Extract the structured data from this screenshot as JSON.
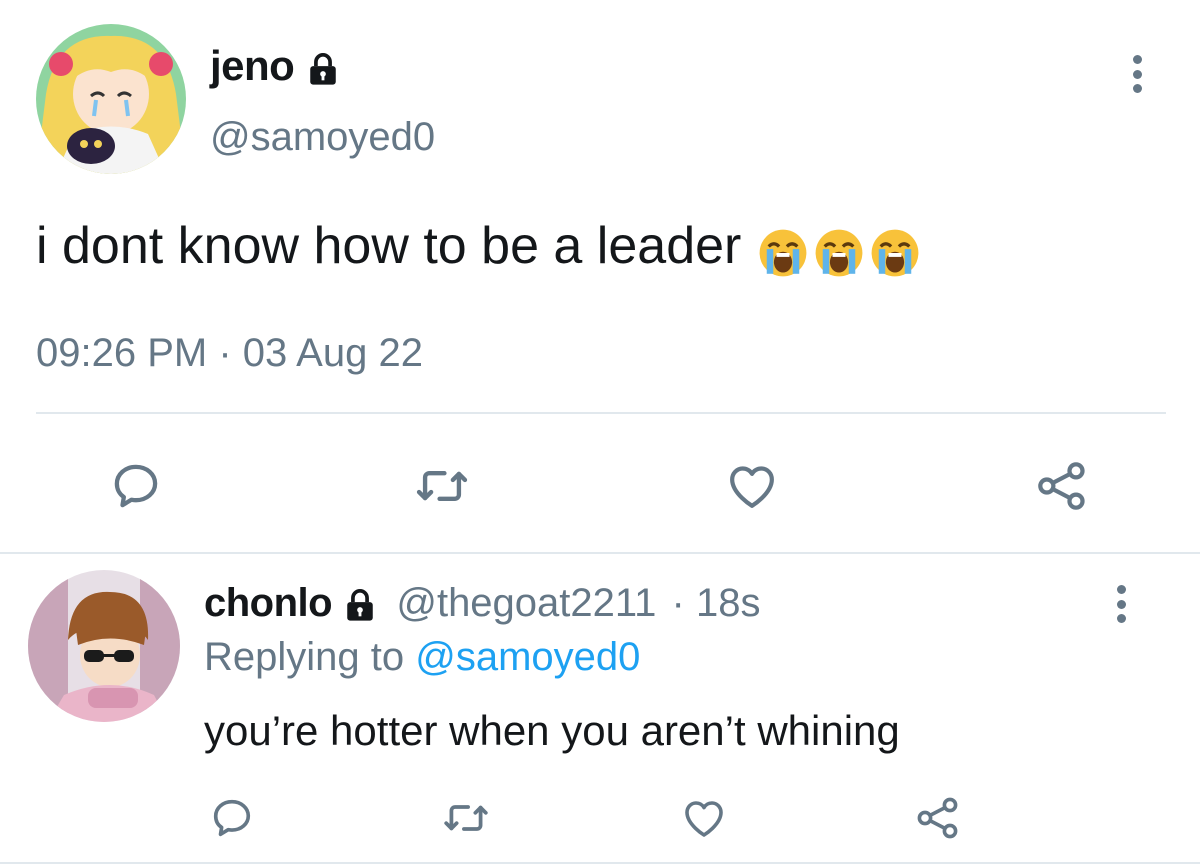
{
  "tweet": {
    "author_name": "jeno",
    "author_handle": "@samoyed0",
    "text": "i dont know how to be a leader",
    "emoji": [
      "loudly-crying-face",
      "loudly-crying-face",
      "loudly-crying-face"
    ],
    "timestamp": "09:26 PM · 03 Aug 22",
    "actions": [
      "reply-icon",
      "retweet-icon",
      "like-icon",
      "share-icon"
    ]
  },
  "reply": {
    "author_name": "chonlo",
    "author_handle": "@thegoat2211",
    "age": "· 18s",
    "replying_prefix": "Replying to",
    "replying_to": "@samoyed0",
    "text": "you’re hotter when you aren’t whining",
    "actions": [
      "reply-icon",
      "retweet-icon",
      "like-icon",
      "share-icon"
    ]
  },
  "colors": {
    "primary_text": "#14171a",
    "secondary_text": "#657786",
    "link": "#1da1f2",
    "divider": "#e1e8ed"
  }
}
